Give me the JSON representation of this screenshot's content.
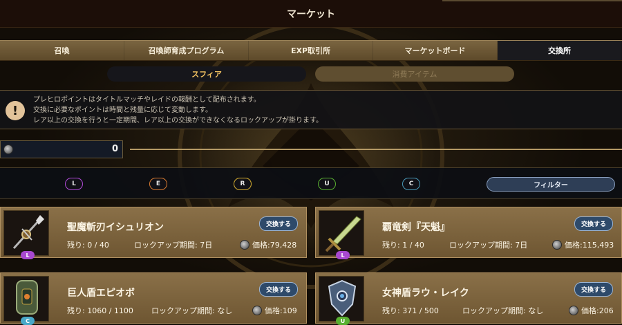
{
  "title": "マーケット",
  "main_tabs": [
    {
      "label": "召喚",
      "active": false
    },
    {
      "label": "召喚師育成プログラム",
      "active": false
    },
    {
      "label": "EXP取引所",
      "active": false
    },
    {
      "label": "マーケットボード",
      "active": false
    },
    {
      "label": "交換所",
      "active": true
    }
  ],
  "sub_tabs": [
    {
      "label": "スフィア",
      "active": true
    },
    {
      "label": "消費アイテム",
      "active": false
    }
  ],
  "info": {
    "icon": "exclamation-icon",
    "lines": [
      "プレヒロポイントはタイトルマッチやレイドの報酬として配布されます。",
      "交換に必要なポイントは時間と残量に応じて変動します。",
      "レア以上の交換を行うと一定期間、レア以上の交換ができなくなるロックアップが掛ります。"
    ]
  },
  "points": {
    "value": "0",
    "icon": "coin-icon"
  },
  "rarity_filters": [
    {
      "label": "L",
      "color": "#b04ad8"
    },
    {
      "label": "E",
      "color": "#d87a30"
    },
    {
      "label": "R",
      "color": "#d8b030"
    },
    {
      "label": "U",
      "color": "#58b030"
    },
    {
      "label": "C",
      "color": "#4a9ab8"
    }
  ],
  "filter_button": "フィルター",
  "items": [
    {
      "name": "聖魔斬刃イシュリオン",
      "remaining": "残り: 0 / 40",
      "lockup": "ロックアップ期間: 7日",
      "price": "価格:79,428",
      "rank": "L",
      "rank_color": "#a848d0",
      "button": "交換する",
      "icon": "spear-icon"
    },
    {
      "name": "覇竜剣『天魁』",
      "remaining": "残り: 1 / 40",
      "lockup": "ロックアップ期間: 7日",
      "price": "価格:115,493",
      "rank": "L",
      "rank_color": "#a848d0",
      "button": "交換する",
      "icon": "sword-icon"
    },
    {
      "name": "巨人盾エピオボ",
      "remaining": "残り: 1060 / 1100",
      "lockup": "ロックアップ期間: なし",
      "price": "価格:109",
      "rank": "C",
      "rank_color": "#48a8c8",
      "button": "交換する",
      "icon": "tower-shield-icon"
    },
    {
      "name": "女神盾ラウ・レイク",
      "remaining": "残り: 371 / 500",
      "lockup": "ロックアップ期間: なし",
      "price": "価格:206",
      "rank": "U",
      "rank_color": "#58b030",
      "button": "交換する",
      "icon": "crest-shield-icon"
    }
  ]
}
